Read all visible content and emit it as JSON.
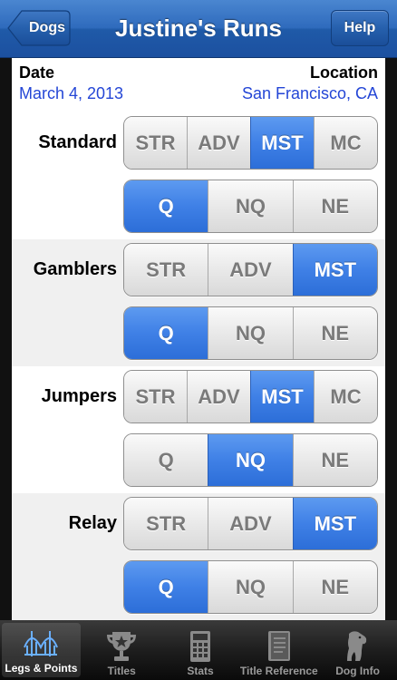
{
  "nav": {
    "title": "Justine's Runs",
    "back_label": "Dogs",
    "help_label": "Help"
  },
  "info": {
    "date_label": "Date",
    "date_value": "March 4, 2013",
    "location_label": "Location",
    "location_value": "San Francisco, CA"
  },
  "classes": [
    {
      "name": "Standard",
      "levels": [
        "STR",
        "ADV",
        "MST",
        "MC"
      ],
      "selected_level": "MST",
      "results": [
        "Q",
        "NQ",
        "NE"
      ],
      "selected_result": "Q"
    },
    {
      "name": "Gamblers",
      "levels": [
        "STR",
        "ADV",
        "MST"
      ],
      "selected_level": "MST",
      "results": [
        "Q",
        "NQ",
        "NE"
      ],
      "selected_result": "Q"
    },
    {
      "name": "Jumpers",
      "levels": [
        "STR",
        "ADV",
        "MST",
        "MC"
      ],
      "selected_level": "MST",
      "results": [
        "Q",
        "NQ",
        "NE"
      ],
      "selected_result": "NQ"
    },
    {
      "name": "Relay",
      "levels": [
        "STR",
        "ADV",
        "MST"
      ],
      "selected_level": "MST",
      "results": [
        "Q",
        "NQ",
        "NE"
      ],
      "selected_result": "Q"
    }
  ],
  "tabs": [
    {
      "label": "Legs & Points",
      "icon": "bridge-icon",
      "active": true
    },
    {
      "label": "Titles",
      "icon": "trophy-icon",
      "active": false
    },
    {
      "label": "Stats",
      "icon": "calculator-icon",
      "active": false
    },
    {
      "label": "Title Reference",
      "icon": "book-icon",
      "active": false
    },
    {
      "label": "Dog Info",
      "icon": "dog-icon",
      "active": false
    }
  ],
  "colors": {
    "nav_blue": "#2f6bbd",
    "selected_blue": "#3f80e6",
    "link_blue": "#2446d6"
  }
}
